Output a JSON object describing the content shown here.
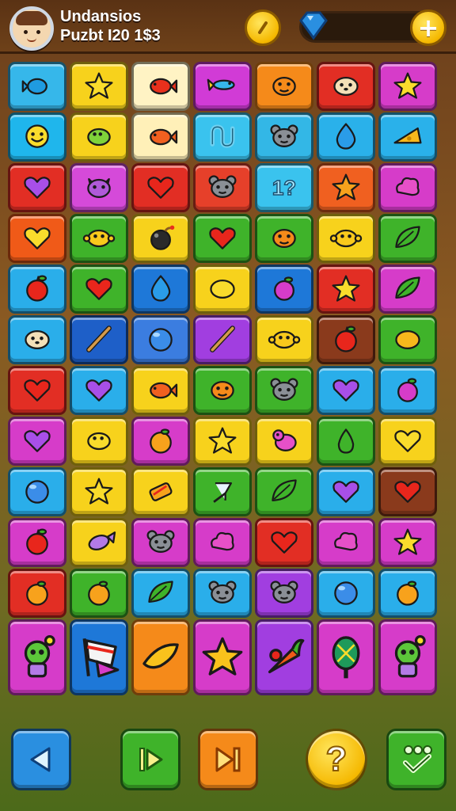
{
  "header": {
    "title_line1": "Undansios",
    "title_line2": "Puzbt I20  1$3",
    "coin_icon": "coin-icon",
    "gem_icon": "blue-gem-icon",
    "add_icon": "plus-icon"
  },
  "board": {
    "rows": [
      [
        {
          "bg": "#36b7ea",
          "icon": "blue-fish"
        },
        {
          "bg": "#f7d21c",
          "icon": "yellow-star"
        },
        {
          "bg": "#fff3c4",
          "icon": "red-fish"
        },
        {
          "bg": "#d13bd6",
          "icon": "blue-fish-small"
        },
        {
          "bg": "#f58a1a",
          "icon": "orange-creature"
        },
        {
          "bg": "#e22e24",
          "icon": "cream-cat"
        },
        {
          "bg": "#d63cc9",
          "icon": "yellow-star"
        }
      ],
      [
        {
          "bg": "#1fb6ec",
          "icon": "yellow-smiley"
        },
        {
          "bg": "#f7d21c",
          "icon": "green-fish"
        },
        {
          "bg": "#fff0b8",
          "icon": "orange-fish"
        },
        {
          "bg": "#3ac3ee",
          "icon": "blue-loop"
        },
        {
          "bg": "#33b7e6",
          "icon": "gray-mouse"
        },
        {
          "bg": "#2ab1ea",
          "icon": "blue-drop"
        },
        {
          "bg": "#2ab1ea",
          "icon": "cheese"
        }
      ],
      [
        {
          "bg": "#e22e24",
          "icon": "purple-heart"
        },
        {
          "bg": "#d54ad9",
          "icon": "purple-cat"
        },
        {
          "bg": "#e22e24",
          "icon": "red-heart"
        },
        {
          "bg": "#e6402a",
          "icon": "gray-mouse"
        },
        {
          "bg": "#3ac3ee",
          "text": "1?"
        },
        {
          "bg": "#f06020",
          "icon": "orange-star"
        },
        {
          "bg": "#d63cc9",
          "icon": "pink-cloud"
        }
      ],
      [
        {
          "bg": "#f05a18",
          "icon": "yellow-heart"
        },
        {
          "bg": "#3fb32a",
          "icon": "yellow-crab"
        },
        {
          "bg": "#f7d21c",
          "icon": "bomb"
        },
        {
          "bg": "#3fb32a",
          "icon": "red-heart"
        },
        {
          "bg": "#3fb32a",
          "icon": "orange-creature"
        },
        {
          "bg": "#f7d21c",
          "icon": "yellow-crab"
        },
        {
          "bg": "#3fb32a",
          "icon": "green-leaf"
        }
      ],
      [
        {
          "bg": "#2aaeea",
          "icon": "red-apple"
        },
        {
          "bg": "#3fb32a",
          "icon": "red-heart"
        },
        {
          "bg": "#1e78d8",
          "icon": "blue-drop"
        },
        {
          "bg": "#f7d21c",
          "icon": "yellow-lemon"
        },
        {
          "bg": "#1e78d8",
          "icon": "pink-berry"
        },
        {
          "bg": "#e22e24",
          "icon": "yellow-star"
        },
        {
          "bg": "#d63cc9",
          "icon": "green-leaf"
        }
      ],
      [
        {
          "bg": "#2aaeea",
          "icon": "cream-cat"
        },
        {
          "bg": "#1e5fc8",
          "icon": "stick"
        },
        {
          "bg": "#3b7de0",
          "icon": "blue-ball"
        },
        {
          "bg": "#a13ee0",
          "icon": "stick"
        },
        {
          "bg": "#f7d21c",
          "icon": "yellow-crab"
        },
        {
          "bg": "#8a3a1c",
          "icon": "red-apple"
        },
        {
          "bg": "#3fb32a",
          "icon": "orange-lemon"
        }
      ],
      [
        {
          "bg": "#e22e24",
          "icon": "red-heart"
        },
        {
          "bg": "#2aaeea",
          "icon": "purple-heart"
        },
        {
          "bg": "#f7d21c",
          "icon": "orange-fish"
        },
        {
          "bg": "#3fb32a",
          "icon": "orange-creature"
        },
        {
          "bg": "#3fb32a",
          "icon": "gray-mouse"
        },
        {
          "bg": "#2aaeea",
          "icon": "purple-heart"
        },
        {
          "bg": "#2aaeea",
          "icon": "pink-berry"
        }
      ],
      [
        {
          "bg": "#d63cc9",
          "icon": "purple-heart"
        },
        {
          "bg": "#f7d21c",
          "icon": "yellow-fish"
        },
        {
          "bg": "#d63cc9",
          "icon": "orange-fruit"
        },
        {
          "bg": "#f7d21c",
          "icon": "yellow-star"
        },
        {
          "bg": "#f7d21c",
          "icon": "pink-bird"
        },
        {
          "bg": "#3fb32a",
          "icon": "green-pear"
        },
        {
          "bg": "#f7d21c",
          "icon": "yellow-heart"
        }
      ],
      [
        {
          "bg": "#2aaeea",
          "icon": "blue-ball"
        },
        {
          "bg": "#f7d21c",
          "icon": "yellow-star"
        },
        {
          "bg": "#f7d21c",
          "icon": "candy"
        },
        {
          "bg": "#3fb32a",
          "icon": "white-cup"
        },
        {
          "bg": "#3fb32a",
          "icon": "green-leaf"
        },
        {
          "bg": "#2aaeea",
          "icon": "purple-heart"
        },
        {
          "bg": "#8a3a1c",
          "icon": "red-heart"
        }
      ],
      [
        {
          "bg": "#d63cc9",
          "icon": "red-apple"
        },
        {
          "bg": "#f7d21c",
          "icon": "purple-fish"
        },
        {
          "bg": "#d63cc9",
          "icon": "gray-mouse"
        },
        {
          "bg": "#d63cc9",
          "icon": "pink-cloud"
        },
        {
          "bg": "#e22e24",
          "icon": "red-heart"
        },
        {
          "bg": "#d63cc9",
          "icon": "pink-cloud"
        },
        {
          "bg": "#d63cc9",
          "icon": "yellow-star"
        }
      ],
      [
        {
          "bg": "#e22e24",
          "icon": "orange-fruit"
        },
        {
          "bg": "#3fb32a",
          "icon": "orange-fruit"
        },
        {
          "bg": "#2aaeea",
          "icon": "green-leaf"
        },
        {
          "bg": "#2aaeea",
          "icon": "gray-mouse"
        },
        {
          "bg": "#a13ee0",
          "icon": "gray-mouse"
        },
        {
          "bg": "#2aaeea",
          "icon": "blue-ball"
        },
        {
          "bg": "#2aaeea",
          "icon": "orange-fruit"
        }
      ],
      [
        {
          "bg": "#d63cc9",
          "icon": "green-goblin"
        },
        {
          "bg": "#1e78d8",
          "icon": "flag"
        },
        {
          "bg": "#f58a1a",
          "icon": "banana"
        },
        {
          "bg": "#d63cc9",
          "icon": "gold-star"
        },
        {
          "bg": "#a13ee0",
          "icon": "carrot"
        },
        {
          "bg": "#d63cc9",
          "icon": "racket"
        },
        {
          "bg": "#d63cc9",
          "icon": "green-goblin"
        }
      ]
    ]
  },
  "controls": {
    "back_icon": "back-triangle-icon",
    "play_icon": "play-icon",
    "skip_icon": "skip-next-icon",
    "help_label": "?",
    "confirm_icon": "check-icon"
  }
}
